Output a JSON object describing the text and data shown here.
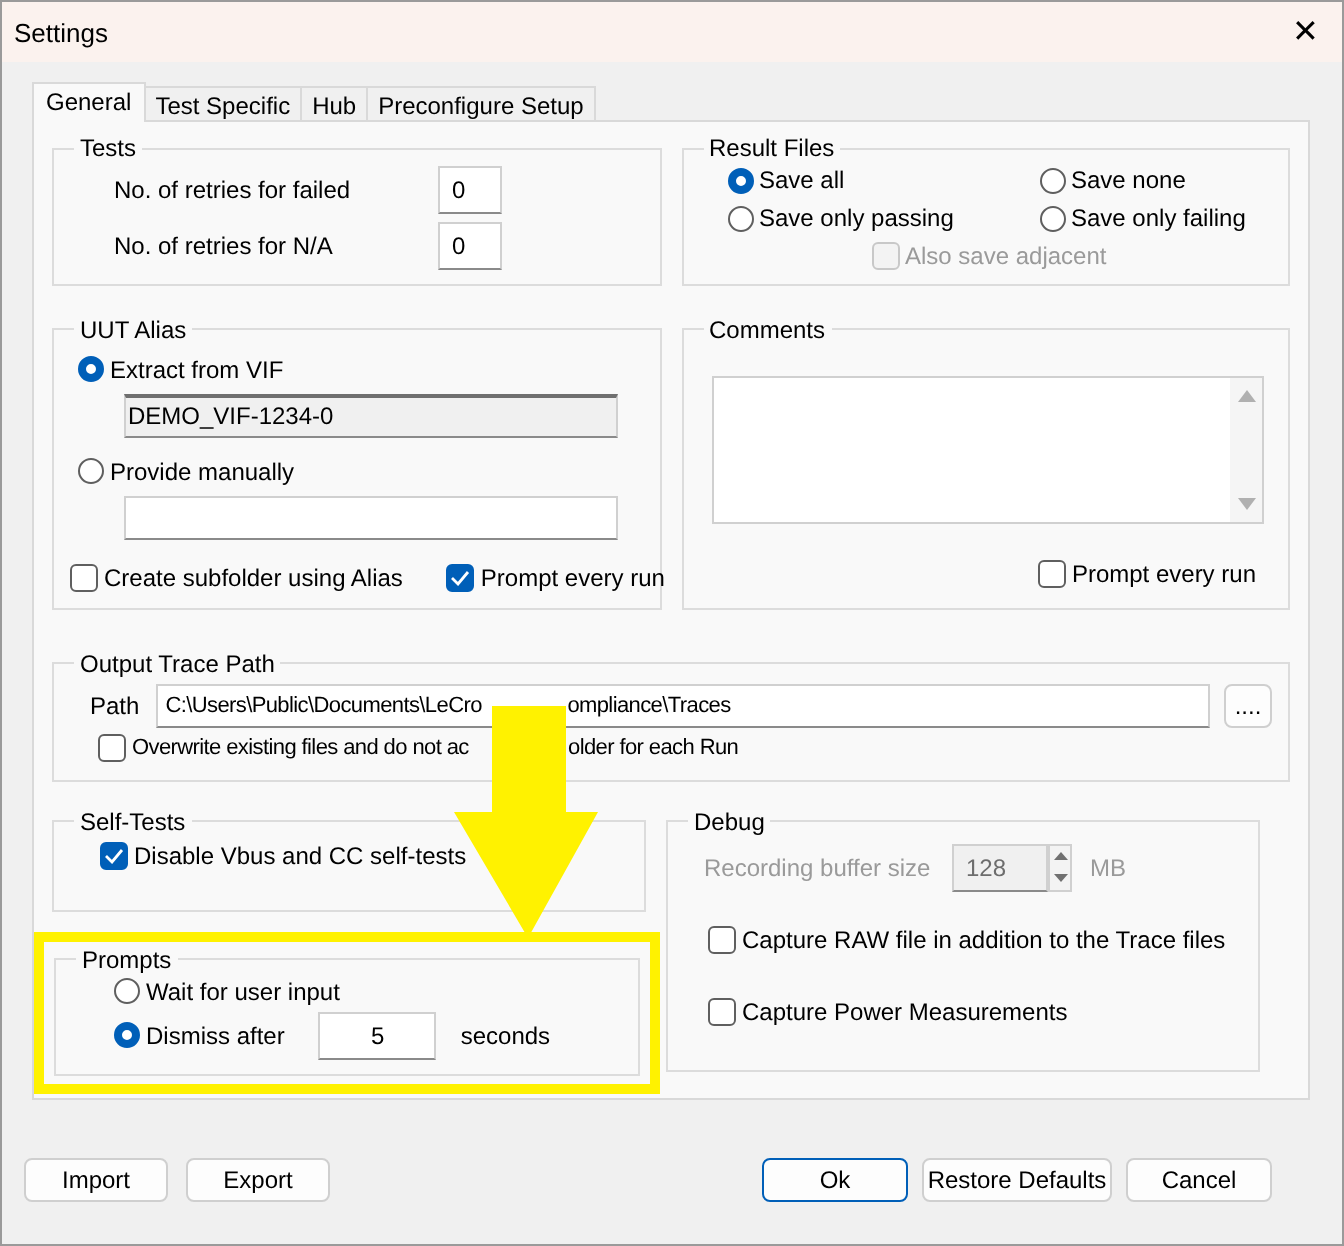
{
  "window": {
    "title": "Settings",
    "close": "✕"
  },
  "tabs": [
    {
      "label": "General",
      "selected": true
    },
    {
      "label": "Test Specific",
      "selected": false
    },
    {
      "label": "Hub",
      "selected": false
    },
    {
      "label": "Preconfigure Setup",
      "selected": false
    }
  ],
  "tests": {
    "title": "Tests",
    "fields": [
      {
        "label": "No. of retries for failed",
        "value": "0"
      },
      {
        "label": "No. of retries for N/A",
        "value": "0"
      }
    ]
  },
  "result_files": {
    "title": "Result Files",
    "options": [
      {
        "label": "Save all",
        "selected": true
      },
      {
        "label": "Save none",
        "selected": false
      },
      {
        "label": "Save only passing",
        "selected": false
      },
      {
        "label": "Save only failing",
        "selected": false
      }
    ],
    "also_save_adjacent": {
      "label": "Also save adjacent",
      "checked": false,
      "disabled": true
    }
  },
  "uut_alias": {
    "title": "UUT Alias",
    "options": [
      {
        "label": "Extract from VIF",
        "selected": true,
        "value": "DEMO_VIF-1234-0",
        "disabled": true
      },
      {
        "label": "Provide manually",
        "selected": false,
        "disabled": false
      }
    ],
    "checkboxes": [
      {
        "label": "Create subfolder using Alias",
        "checked": false
      },
      {
        "label": "Prompt every run",
        "checked": true
      }
    ]
  },
  "comments": {
    "title": "Comments",
    "prompt_every_run": {
      "label": "Prompt every run",
      "checked": false
    }
  },
  "output_trace_path": {
    "title": "Output Trace Path",
    "path_label": "Path",
    "path_parts": [
      "C:\\Users\\Public\\Documents\\LeCro",
      "ompliance\\Traces"
    ],
    "browse": "....",
    "overwrite": {
      "label_parts": [
        "Overwrite existing files and do not ac",
        "older for each Run"
      ],
      "checked": false
    }
  },
  "self_tests": {
    "title": "Self-Tests",
    "checkbox": {
      "label": "Disable Vbus and CC self-tests",
      "checked": true
    }
  },
  "prompts": {
    "title": "Prompts",
    "highlighted": true,
    "options": [
      {
        "label": "Wait for user input",
        "selected": false
      },
      {
        "label": "Dismiss after",
        "selected": true
      }
    ],
    "seconds_value": "5",
    "seconds_unit": "seconds"
  },
  "debug": {
    "title": "Debug",
    "buffer": {
      "label": "Recording buffer size",
      "value": "128",
      "unit": "MB",
      "disabled": true
    },
    "checkboxes": [
      {
        "label": "Capture RAW file in addition to the Trace files",
        "checked": false
      },
      {
        "label": "Capture Power Measurements",
        "checked": false
      }
    ]
  },
  "buttons_left": [
    {
      "label": "Import",
      "default": false
    },
    {
      "label": "Export",
      "default": false
    }
  ],
  "buttons_right": [
    {
      "label": "Ok",
      "default": true
    },
    {
      "label": "Restore Defaults",
      "default": false
    },
    {
      "label": "Cancel",
      "default": false
    }
  ]
}
